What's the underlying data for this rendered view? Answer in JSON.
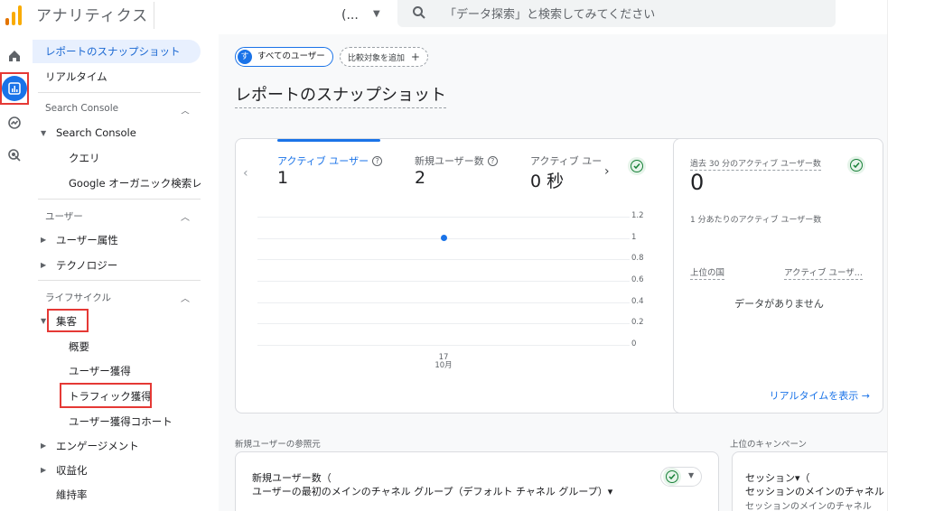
{
  "app": {
    "title": "アナリティクス",
    "account_selector": "(...",
    "brand_colors": {
      "orange": "#f9ab00",
      "dark_orange": "#e37400",
      "accent": "#1a73e8",
      "highlight": "#e53935"
    }
  },
  "search": {
    "placeholder": "「データ探索」と検索してみてください"
  },
  "rail": {
    "items": [
      {
        "icon": "home-icon"
      },
      {
        "icon": "reports-icon",
        "active": true
      },
      {
        "icon": "explore-icon"
      },
      {
        "icon": "advertising-icon"
      }
    ]
  },
  "sidebar": {
    "snapshot": "レポートのスナップショット",
    "realtime": "リアルタイム",
    "search_console_section": "Search Console",
    "search_console_group": "Search Console",
    "queries": "クエリ",
    "organic": "Google オーガニック検索レ...",
    "user_section": "ユーザー",
    "user_attributes": "ユーザー属性",
    "technology": "テクノロジー",
    "lifecycle_section": "ライフサイクル",
    "acquisition": "集客",
    "overview": "概要",
    "user_acquisition": "ユーザー獲得",
    "traffic_acquisition": "トラフィック獲得",
    "user_acquisition_cohort": "ユーザー獲得コホート",
    "engagement": "エンゲージメント",
    "monetization": "収益化",
    "retention": "維持率"
  },
  "main": {
    "chip_user_avatar": "す",
    "chip_user_label": "すべてのユーザー",
    "chip_compare_label": "比較対象を追加",
    "chip_compare_icon": "+",
    "page_title": "レポートのスナップショット",
    "metrics": [
      {
        "label": "アクティブ ユーザー",
        "value": "1"
      },
      {
        "label": "新規ユーザー数",
        "value": "2"
      },
      {
        "label": "アクティブ ユー",
        "value": "0 秒"
      }
    ],
    "realtime": {
      "title": "過去 30 分のアクティブ ユーザー数",
      "value": "0",
      "per_minute": "1 分あたりのアクティブ ユーザー数",
      "col_country": "上位の国",
      "col_users": "アクティブ ユーザ...",
      "empty": "データがありません",
      "link": "リアルタイムを表示 →"
    },
    "referral_section": "新規ユーザーの参照元",
    "campaign_section": "上位のキャンペーン",
    "referral_card_title": "新規ユーザー数（",
    "referral_card_dim": "ユーザーの最初のメインのチャネル グループ（デフォルト チャネル グループ）▾",
    "campaign_card_title": "セッション▾（",
    "campaign_card_dim": "セッションのメインのチャネル グ",
    "campaign_card_dim2": "セッションのメインのチャネル"
  },
  "chart_data": {
    "type": "scatter",
    "x": [
      "17 10月"
    ],
    "y": [
      1
    ],
    "xtick_labels": [
      [
        "17",
        "10月"
      ]
    ],
    "yticks": [
      "1.2",
      "1",
      "0.8",
      "0.6",
      "0.4",
      "0.2",
      "0"
    ],
    "ylim": [
      0,
      1.2
    ],
    "grid": true,
    "color": "#1a73e8"
  }
}
